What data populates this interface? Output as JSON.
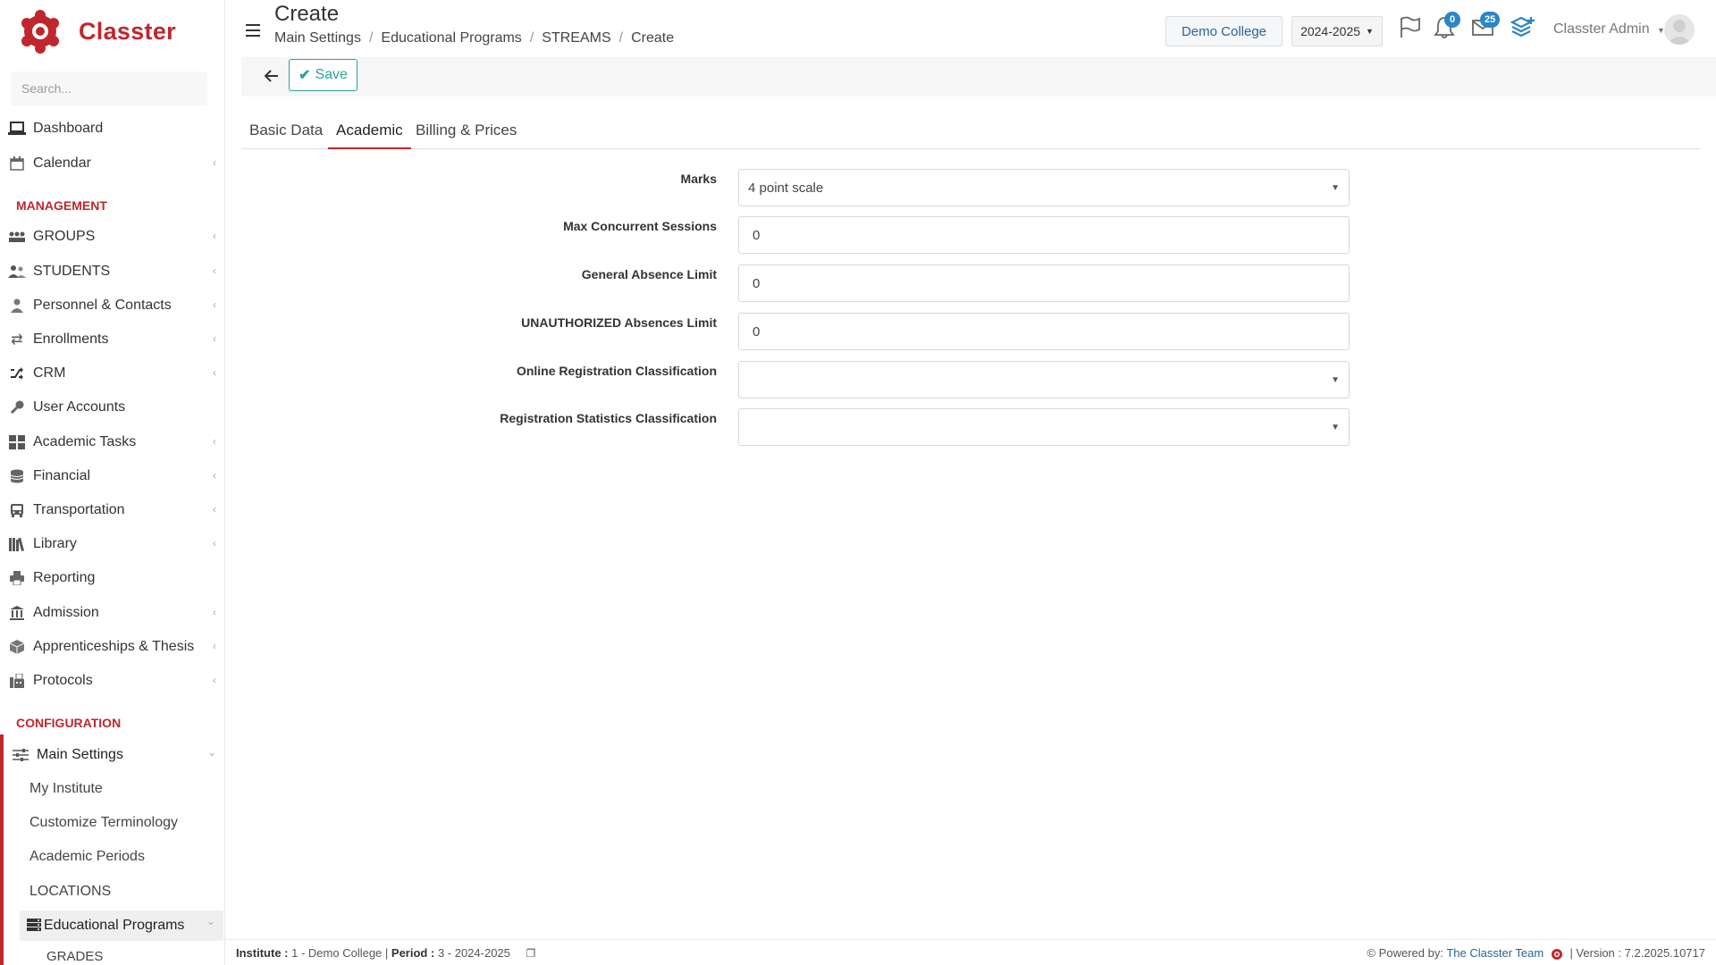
{
  "app": {
    "name": "Classter"
  },
  "search": {
    "placeholder": "Search..."
  },
  "sidebar": {
    "top_items": [
      {
        "label": "Dashboard",
        "icon": "laptop-icon"
      },
      {
        "label": "Calendar",
        "icon": "calendar-icon"
      }
    ],
    "management_header": "MANAGEMENT",
    "management_items": [
      {
        "label": "GROUPS",
        "icon": "groups-icon"
      },
      {
        "label": "STUDENTS",
        "icon": "students-icon"
      },
      {
        "label": "Personnel & Contacts",
        "icon": "person-icon"
      },
      {
        "label": "Enrollments",
        "icon": "exchange-icon"
      },
      {
        "label": "CRM",
        "icon": "random-icon"
      },
      {
        "label": "User Accounts",
        "icon": "key-icon"
      },
      {
        "label": "Academic Tasks",
        "icon": "grid-icon"
      },
      {
        "label": "Financial",
        "icon": "coins-icon"
      },
      {
        "label": "Transportation",
        "icon": "bus-icon"
      },
      {
        "label": "Library",
        "icon": "books-icon"
      },
      {
        "label": "Reporting",
        "icon": "print-icon"
      },
      {
        "label": "Admission",
        "icon": "institution-icon"
      },
      {
        "label": "Apprenticeships & Thesis",
        "icon": "box-icon"
      },
      {
        "label": "Protocols",
        "icon": "fax-icon"
      }
    ],
    "configuration_header": "CONFIGURATION",
    "main_settings": "Main Settings",
    "sub_items": [
      "My Institute",
      "Customize Terminology",
      "Academic Periods",
      "LOCATIONS"
    ],
    "educational_programs": "Educational Programs",
    "grades": "GRADES"
  },
  "header": {
    "title": "Create",
    "breadcrumb": [
      "Main Settings",
      "Educational Programs",
      "STREAMS",
      "Create"
    ],
    "college": "Demo College",
    "year": "2024-2025",
    "notifications_count": "0",
    "messages_count": "25",
    "user": "Classter Admin"
  },
  "toolbar": {
    "save_label": "Save"
  },
  "tabs": [
    {
      "label": "Basic Data",
      "active": false
    },
    {
      "label": "Academic",
      "active": true
    },
    {
      "label": "Billing & Prices",
      "active": false
    }
  ],
  "form": {
    "marks": {
      "label": "Marks",
      "value": "4 point scale"
    },
    "max_sessions": {
      "label": "Max Concurrent Sessions",
      "value": "0"
    },
    "absence_limit": {
      "label": "General Absence Limit",
      "value": "0"
    },
    "unauth_limit": {
      "label": "UNAUTHORIZED Absences Limit",
      "value": "0"
    },
    "online_reg": {
      "label": "Online Registration Classification",
      "value": ""
    },
    "reg_stats": {
      "label": "Registration Statistics Classification",
      "value": ""
    }
  },
  "footer": {
    "institute_label": "Institute :",
    "institute_value": "1 - Demo College",
    "period_label": "Period :",
    "period_value": "3 - 2024-2025",
    "powered_by": "Powered by:",
    "team": "The Classter Team",
    "version": "| Version : 7.2.2025.10717"
  },
  "colors": {
    "brand": "#c0272d",
    "accent": "#2a86c8",
    "save": "#2aa39a"
  }
}
